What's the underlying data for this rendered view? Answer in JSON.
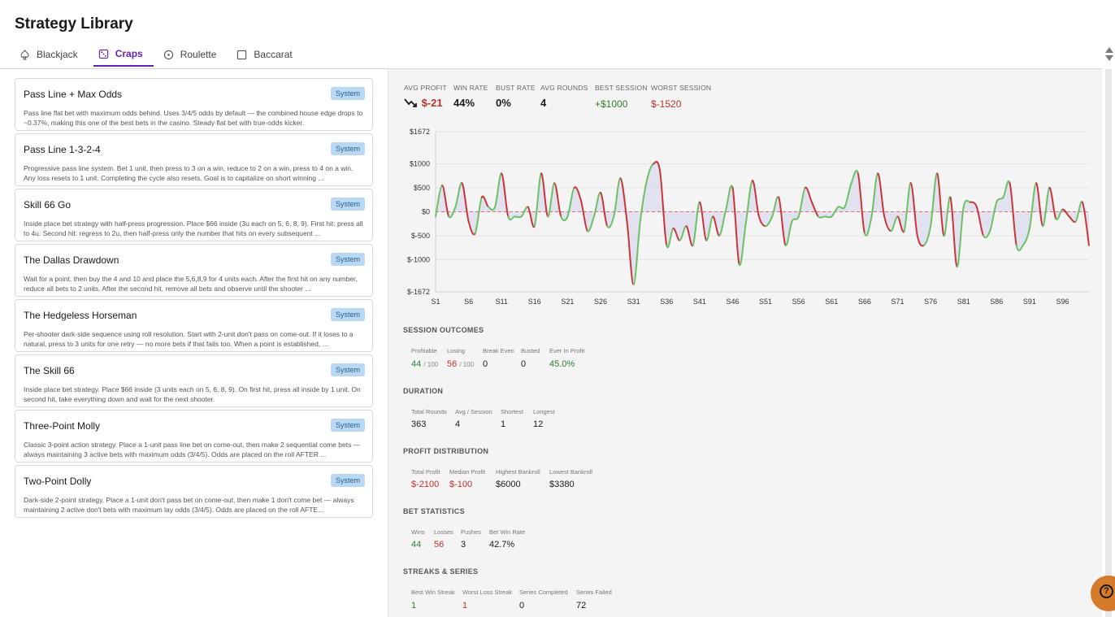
{
  "app": {
    "title": "Strategy Library"
  },
  "tabs": [
    {
      "label": "Blackjack",
      "icon": "spade-icon"
    },
    {
      "label": "Craps",
      "icon": "dice-icon",
      "active": true
    },
    {
      "label": "Roulette",
      "icon": "roulette-icon"
    },
    {
      "label": "Baccarat",
      "icon": "card-icon"
    }
  ],
  "strategies": [
    {
      "title": "Pass Line + Max Odds",
      "badge": "System",
      "desc": "Pass line flat bet with maximum odds behind. Uses 3/4/5 odds by default — the combined house edge drops to ~0.37%, making this one of the best bets in the casino. Steady flat bet with true-odds kicker."
    },
    {
      "title": "Pass Line 1-3-2-4",
      "badge": "System",
      "desc": "Progressive pass line system. Bet 1 unit, then press to 3 on a win, reduce to 2 on a win, press to 4 on a win. Any loss resets to 1 unit. Completing the cycle also resets. Goal is to capitalize on short winning ..."
    },
    {
      "title": "Skill 66 Go",
      "badge": "System",
      "desc": "Inside place bet strategy with half-press progression. Place $66 inside (3u each on 5, 6, 8, 9). First hit: press all to 4u. Second hit: regress to 2u, then half-press only the number that hits on every subsequent ..."
    },
    {
      "title": "The Dallas Drawdown",
      "badge": "System",
      "desc": "Wait for a point, then buy the 4 and 10 and place the 5,6,8,9 for 4 units each. After the first hit on any number, reduce all bets to 2 units. After the second hit, remove all bets and observe until the shooter ..."
    },
    {
      "title": "The Hedgeless Horseman",
      "badge": "System",
      "desc": "Per-shooter dark-side sequence using roll resolution. Start with 2-unit don't pass on come-out. If it loses to a natural, press to 3 units for one retry — no more bets if that fails too. When a point is established, ..."
    },
    {
      "title": "The Skill 66",
      "badge": "System",
      "desc": "Inside place bet strategy. Place $66 inside (3 units each on 5, 6, 8, 9). On first hit, press all inside by 1 unit. On second hit, take everything down and wait for the next shooter."
    },
    {
      "title": "Three-Point Molly",
      "badge": "System",
      "desc": "Classic 3-point action strategy. Place a 1-unit pass line bet on come-out, then make 2 sequential come bets — always maintaining 3 active bets with maximum odds (3/4/5). Odds are placed on the roll AFTER ..."
    },
    {
      "title": "Two-Point Dolly",
      "badge": "System",
      "desc": "Dark-side 2-point strategy. Place a 1-unit don't pass bet on come-out, then make 1 don't come bet — always maintaining 2 active don't bets with maximum lay odds (3/4/5). Odds are placed on the roll AFTE..."
    }
  ],
  "summary": {
    "avg_profit_label": "AVG PROFIT",
    "avg_profit": "$-21",
    "win_rate_label": "WIN RATE",
    "win_rate": "44%",
    "bust_rate_label": "BUST RATE",
    "bust_rate": "0%",
    "avg_rounds_label": "AVG ROUNDS",
    "avg_rounds": "4",
    "best_session_label": "BEST SESSION",
    "best_session": "+$1000",
    "worst_session_label": "WORST SESSION",
    "worst_session": "$-1520"
  },
  "chart_data": {
    "type": "line",
    "y_tick_labels": [
      "$1672",
      "$1000",
      "$500",
      "$0",
      "$-500",
      "$-1000",
      "$-1672"
    ],
    "y_ticks": [
      1672,
      1000,
      500,
      0,
      -500,
      -1000,
      -1672
    ],
    "ylim": [
      -1672,
      1672
    ],
    "x_tick_labels": [
      "S1",
      "S6",
      "S11",
      "S16",
      "S21",
      "S26",
      "S31",
      "S36",
      "S41",
      "S46",
      "S51",
      "S56",
      "S61",
      "S66",
      "S71",
      "S76",
      "S81",
      "S86",
      "S91",
      "S96"
    ],
    "x": [
      1,
      2,
      3,
      4,
      5,
      6,
      7,
      8,
      9,
      10,
      11,
      12,
      13,
      14,
      15,
      16,
      17,
      18,
      19,
      20,
      21,
      22,
      23,
      24,
      25,
      26,
      27,
      28,
      29,
      30,
      31,
      32,
      33,
      34,
      35,
      36,
      37,
      38,
      39,
      40,
      41,
      42,
      43,
      44,
      45,
      46,
      47,
      48,
      49,
      50,
      51,
      52,
      53,
      54,
      55,
      56,
      57,
      58,
      59,
      60,
      61,
      62,
      63,
      64,
      65,
      66,
      67,
      68,
      69,
      70,
      71,
      72,
      73,
      74,
      75,
      76,
      77,
      78,
      79,
      80,
      81,
      82,
      83,
      84,
      85,
      86,
      87,
      88,
      89,
      90,
      91,
      92,
      93,
      94,
      95,
      96,
      97,
      98,
      99,
      100
    ],
    "y": [
      -100,
      550,
      -100,
      100,
      600,
      -200,
      -450,
      300,
      100,
      100,
      800,
      -100,
      -100,
      -100,
      100,
      -300,
      800,
      -100,
      600,
      -100,
      -100,
      500,
      250,
      -400,
      -100,
      400,
      -300,
      -100,
      700,
      -200,
      -1520,
      -200,
      650,
      1000,
      850,
      -700,
      -350,
      -600,
      -300,
      -700,
      200,
      -600,
      -100,
      -500,
      50,
      500,
      -1100,
      -250,
      650,
      -100,
      -300,
      -100,
      300,
      -700,
      -200,
      -100,
      500,
      200,
      -100,
      -100,
      -100,
      100,
      100,
      600,
      800,
      -450,
      -150,
      800,
      -100,
      -400,
      -100,
      -400,
      600,
      -500,
      -700,
      -300,
      800,
      -500,
      300,
      -1150,
      100,
      200,
      100,
      -500,
      -400,
      200,
      300,
      600,
      -700,
      -700,
      -350,
      600,
      -300,
      500,
      -150,
      50,
      -100,
      -200,
      200,
      -700
    ],
    "colors": {
      "up": "#6cc165",
      "down": "#c9363a",
      "zero": "#e06a6a",
      "fill": "#d9d9ec"
    }
  },
  "outcomes": {
    "title": "SESSION OUTCOMES",
    "profitable_label": "Profitable",
    "profitable": "44",
    "profitable_of": "/ 100",
    "losing_label": "Losing",
    "losing": "56",
    "losing_of": "/ 100",
    "break_even_label": "Break Even",
    "break_even": "0",
    "busted_label": "Busted",
    "busted": "0",
    "ever_label": "Ever In Profit",
    "ever": "45.0%"
  },
  "duration": {
    "title": "DURATION",
    "total_label": "Total Rounds",
    "total": "363",
    "avg_label": "Avg / Session",
    "avg": "4",
    "shortest_label": "Shortest",
    "shortest": "1",
    "longest_label": "Longest",
    "longest": "12"
  },
  "profit_dist": {
    "title": "PROFIT DISTRIBUTION",
    "total_label": "Total Profit",
    "total": "$-2100",
    "median_label": "Median Profit",
    "median": "$-100",
    "highest_label": "Highest Bankroll",
    "highest": "$6000",
    "lowest_label": "Lowest Bankroll",
    "lowest": "$3380"
  },
  "bet_stats": {
    "title": "BET STATISTICS",
    "wins_label": "Wins",
    "wins": "44",
    "losses_label": "Losses",
    "losses": "56",
    "pushes_label": "Pushes",
    "pushes": "3",
    "rate_label": "Bet Win Rate",
    "rate": "42.7%"
  },
  "streaks": {
    "title": "STREAKS & SERIES",
    "best_label": "Best Win Streak",
    "best": "1",
    "worst_label": "Worst Loss Streak",
    "worst": "1",
    "completed_label": "Series Completed",
    "completed": "0",
    "failed_label": "Series Failed",
    "failed": "72"
  },
  "help": {
    "glyph": "?"
  }
}
